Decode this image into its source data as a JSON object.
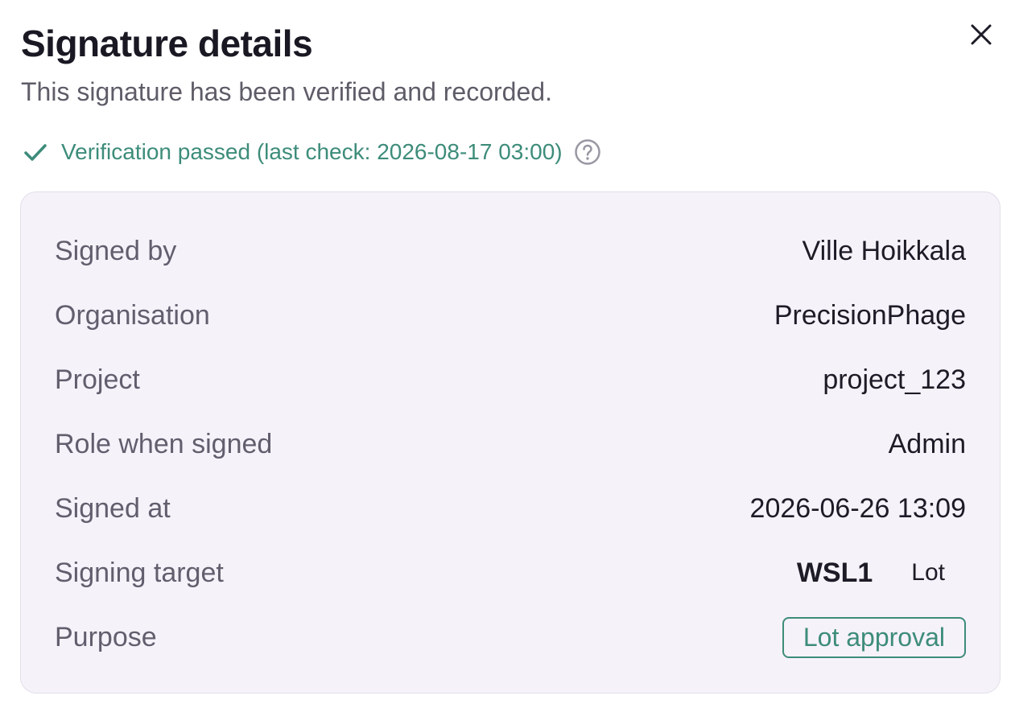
{
  "dialog": {
    "title": "Signature details",
    "subtitle": "This signature has been verified and recorded.",
    "close_icon": "close-icon"
  },
  "verification": {
    "text": "Verification passed (last check: 2026-08-17 03:00)",
    "status_icon": "check-icon",
    "help_icon": "help-circle-icon",
    "color": "#3d8c7a"
  },
  "details": {
    "signed_by": {
      "label": "Signed by",
      "value": "Ville Hoikkala"
    },
    "organisation": {
      "label": "Organisation",
      "value": "PrecisionPhage"
    },
    "project": {
      "label": "Project",
      "value": "project_123"
    },
    "role": {
      "label": "Role when signed",
      "value": "Admin"
    },
    "signed_at": {
      "label": "Signed at",
      "value": "2026-06-26 13:09"
    },
    "signing_target": {
      "label": "Signing target",
      "code": "WSL1",
      "type": "Lot"
    },
    "purpose": {
      "label": "Purpose",
      "value": "Lot approval"
    }
  },
  "colors": {
    "accent": "#3d8c7a",
    "card_background": "#f6f2fa"
  }
}
